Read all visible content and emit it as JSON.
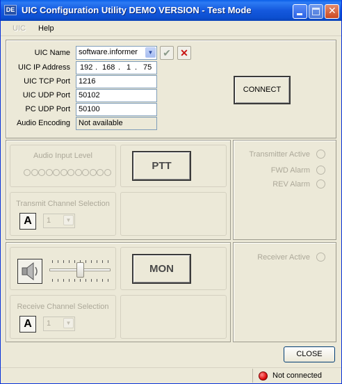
{
  "window": {
    "title": "UIC Configuration Utility DEMO VERSION - Test Mode",
    "icon_text": "DE"
  },
  "menu": {
    "items": [
      {
        "label": "UIC"
      },
      {
        "label": "Help"
      }
    ]
  },
  "connection": {
    "uic_name_label": "UIC Name",
    "uic_name_value": "software.informer",
    "ip_label": "UIC IP Address",
    "ip_octets": [
      "192",
      "168",
      "1",
      "75"
    ],
    "tcp_label": "UIC TCP Port",
    "tcp_value": "1216",
    "udp_label": "UIC UDP Port",
    "udp_value": "50102",
    "pc_udp_label": "PC UDP Port",
    "pc_udp_value": "50100",
    "audio_label": "Audio Encoding",
    "audio_value": "Not available",
    "connect_label": "CONNECT"
  },
  "transmit": {
    "audio_input_label": "Audio Input Level",
    "level_dots": 12,
    "ptt_label": "PTT",
    "channel_label": "Transmit Channel Selection",
    "channel_letter": "A",
    "channel_number": "1"
  },
  "tx_status": {
    "transmitter_active": "Transmitter Active",
    "fwd_alarm": "FWD Alarm",
    "rev_alarm": "REV Alarm"
  },
  "receive": {
    "mon_label": "MON",
    "channel_label": "Receive Channel Selection",
    "channel_letter": "A",
    "channel_number": "1",
    "volume_level": 0.5
  },
  "rx_status": {
    "receiver_active": "Receiver Active"
  },
  "footer": {
    "close_label": "CLOSE"
  },
  "status": {
    "connection_text": "Not connected",
    "led_color": "#e01010"
  }
}
